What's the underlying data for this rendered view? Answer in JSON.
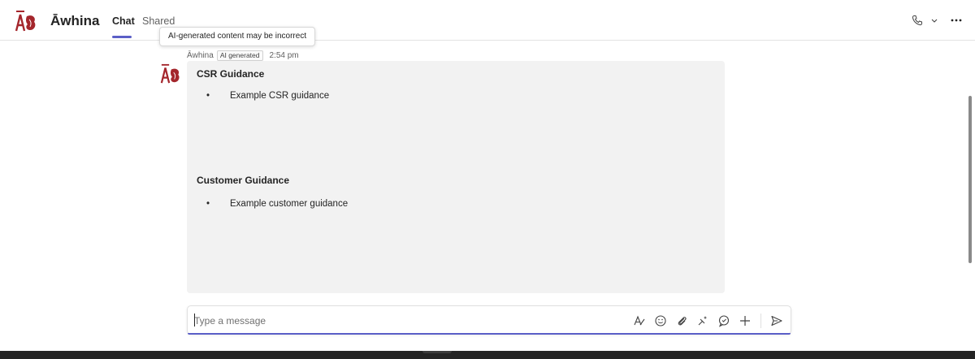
{
  "app": {
    "name": "Āwhina"
  },
  "tabs": [
    {
      "label": "Chat"
    },
    {
      "label": "Shared"
    }
  ],
  "tooltip": "AI-generated content may be incorrect",
  "message": {
    "sender": "Āwhina",
    "badge": "AI generated",
    "time": "2:54 pm",
    "sections": [
      {
        "title": "CSR Guidance",
        "bullets": [
          "Example CSR guidance"
        ]
      },
      {
        "title": "Customer Guidance",
        "bullets": [
          "Example customer guidance"
        ]
      }
    ],
    "bullet_char": "•"
  },
  "composer": {
    "placeholder": "Type a message"
  },
  "colors": {
    "accent": "#5b5fc7",
    "logo": "#a4262c",
    "bubble": "#f2f2f2"
  },
  "icons": [
    "phone-icon",
    "chevron-down-icon",
    "more-options-icon",
    "format-icon",
    "emoji-icon",
    "attach-icon",
    "loop-icon",
    "praise-icon",
    "plus-icon",
    "send-icon"
  ]
}
